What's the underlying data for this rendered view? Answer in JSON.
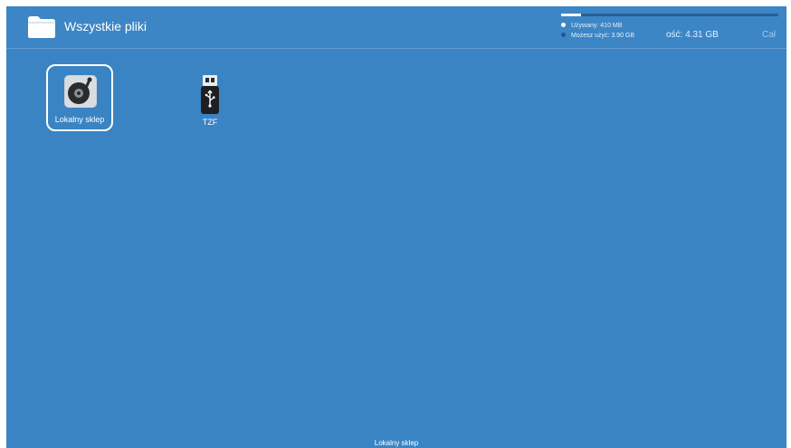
{
  "header": {
    "title": "Wszystkie pliki",
    "folder_icon": "folder-icon"
  },
  "storage": {
    "used_label": "Używany: 410 MB",
    "available_label": "Możesz użyć: 3.90 GB",
    "capacity_label": "ość: 4.31 GB",
    "capacity_label_2": "Cał",
    "used_fraction": 0.09,
    "used_color": "#ffffff",
    "track_color": "#23578f"
  },
  "devices": [
    {
      "label": "Lokalny sklep",
      "icon": "local-storage-disk-icon",
      "selected": true
    },
    {
      "label": "TZF",
      "icon": "usb-drive-icon",
      "selected": false
    }
  ],
  "footer": {
    "label": "Lokalny sklep"
  },
  "colors": {
    "background": "#3a84c4",
    "text": "#ffffff"
  }
}
